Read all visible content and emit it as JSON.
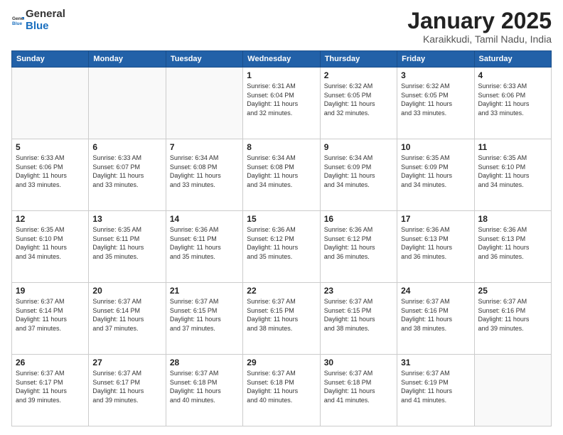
{
  "logo": {
    "general": "General",
    "blue": "Blue"
  },
  "header": {
    "month": "January 2025",
    "location": "Karaikkudi, Tamil Nadu, India"
  },
  "days_header": [
    "Sunday",
    "Monday",
    "Tuesday",
    "Wednesday",
    "Thursday",
    "Friday",
    "Saturday"
  ],
  "weeks": [
    [
      {
        "day": "",
        "info": ""
      },
      {
        "day": "",
        "info": ""
      },
      {
        "day": "",
        "info": ""
      },
      {
        "day": "1",
        "info": "Sunrise: 6:31 AM\nSunset: 6:04 PM\nDaylight: 11 hours\nand 32 minutes."
      },
      {
        "day": "2",
        "info": "Sunrise: 6:32 AM\nSunset: 6:05 PM\nDaylight: 11 hours\nand 32 minutes."
      },
      {
        "day": "3",
        "info": "Sunrise: 6:32 AM\nSunset: 6:05 PM\nDaylight: 11 hours\nand 33 minutes."
      },
      {
        "day": "4",
        "info": "Sunrise: 6:33 AM\nSunset: 6:06 PM\nDaylight: 11 hours\nand 33 minutes."
      }
    ],
    [
      {
        "day": "5",
        "info": "Sunrise: 6:33 AM\nSunset: 6:06 PM\nDaylight: 11 hours\nand 33 minutes."
      },
      {
        "day": "6",
        "info": "Sunrise: 6:33 AM\nSunset: 6:07 PM\nDaylight: 11 hours\nand 33 minutes."
      },
      {
        "day": "7",
        "info": "Sunrise: 6:34 AM\nSunset: 6:08 PM\nDaylight: 11 hours\nand 33 minutes."
      },
      {
        "day": "8",
        "info": "Sunrise: 6:34 AM\nSunset: 6:08 PM\nDaylight: 11 hours\nand 34 minutes."
      },
      {
        "day": "9",
        "info": "Sunrise: 6:34 AM\nSunset: 6:09 PM\nDaylight: 11 hours\nand 34 minutes."
      },
      {
        "day": "10",
        "info": "Sunrise: 6:35 AM\nSunset: 6:09 PM\nDaylight: 11 hours\nand 34 minutes."
      },
      {
        "day": "11",
        "info": "Sunrise: 6:35 AM\nSunset: 6:10 PM\nDaylight: 11 hours\nand 34 minutes."
      }
    ],
    [
      {
        "day": "12",
        "info": "Sunrise: 6:35 AM\nSunset: 6:10 PM\nDaylight: 11 hours\nand 34 minutes."
      },
      {
        "day": "13",
        "info": "Sunrise: 6:35 AM\nSunset: 6:11 PM\nDaylight: 11 hours\nand 35 minutes."
      },
      {
        "day": "14",
        "info": "Sunrise: 6:36 AM\nSunset: 6:11 PM\nDaylight: 11 hours\nand 35 minutes."
      },
      {
        "day": "15",
        "info": "Sunrise: 6:36 AM\nSunset: 6:12 PM\nDaylight: 11 hours\nand 35 minutes."
      },
      {
        "day": "16",
        "info": "Sunrise: 6:36 AM\nSunset: 6:12 PM\nDaylight: 11 hours\nand 36 minutes."
      },
      {
        "day": "17",
        "info": "Sunrise: 6:36 AM\nSunset: 6:13 PM\nDaylight: 11 hours\nand 36 minutes."
      },
      {
        "day": "18",
        "info": "Sunrise: 6:36 AM\nSunset: 6:13 PM\nDaylight: 11 hours\nand 36 minutes."
      }
    ],
    [
      {
        "day": "19",
        "info": "Sunrise: 6:37 AM\nSunset: 6:14 PM\nDaylight: 11 hours\nand 37 minutes."
      },
      {
        "day": "20",
        "info": "Sunrise: 6:37 AM\nSunset: 6:14 PM\nDaylight: 11 hours\nand 37 minutes."
      },
      {
        "day": "21",
        "info": "Sunrise: 6:37 AM\nSunset: 6:15 PM\nDaylight: 11 hours\nand 37 minutes."
      },
      {
        "day": "22",
        "info": "Sunrise: 6:37 AM\nSunset: 6:15 PM\nDaylight: 11 hours\nand 38 minutes."
      },
      {
        "day": "23",
        "info": "Sunrise: 6:37 AM\nSunset: 6:15 PM\nDaylight: 11 hours\nand 38 minutes."
      },
      {
        "day": "24",
        "info": "Sunrise: 6:37 AM\nSunset: 6:16 PM\nDaylight: 11 hours\nand 38 minutes."
      },
      {
        "day": "25",
        "info": "Sunrise: 6:37 AM\nSunset: 6:16 PM\nDaylight: 11 hours\nand 39 minutes."
      }
    ],
    [
      {
        "day": "26",
        "info": "Sunrise: 6:37 AM\nSunset: 6:17 PM\nDaylight: 11 hours\nand 39 minutes."
      },
      {
        "day": "27",
        "info": "Sunrise: 6:37 AM\nSunset: 6:17 PM\nDaylight: 11 hours\nand 39 minutes."
      },
      {
        "day": "28",
        "info": "Sunrise: 6:37 AM\nSunset: 6:18 PM\nDaylight: 11 hours\nand 40 minutes."
      },
      {
        "day": "29",
        "info": "Sunrise: 6:37 AM\nSunset: 6:18 PM\nDaylight: 11 hours\nand 40 minutes."
      },
      {
        "day": "30",
        "info": "Sunrise: 6:37 AM\nSunset: 6:18 PM\nDaylight: 11 hours\nand 41 minutes."
      },
      {
        "day": "31",
        "info": "Sunrise: 6:37 AM\nSunset: 6:19 PM\nDaylight: 11 hours\nand 41 minutes."
      },
      {
        "day": "",
        "info": ""
      }
    ]
  ]
}
